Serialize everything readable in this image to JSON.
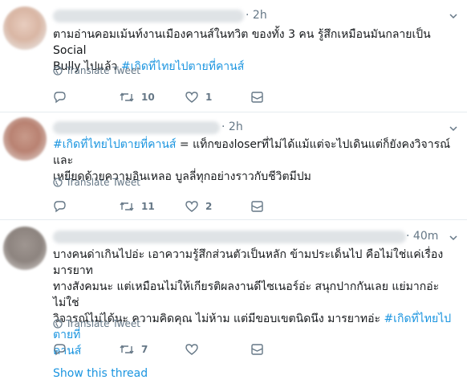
{
  "tweets": [
    {
      "time": "2h",
      "text_lines": [
        {
          "plain": "ตามอ่านคอมเม้นท์งานเมืองคานส์ในทวิต ของทั้ง 3 คน รู้สึกเหมือนมันกลายเป็น Social"
        },
        {
          "plain": "Bully ไปแล้ว ",
          "hashtag": "#เกิดที่ไทยไปตายที่คานส์"
        }
      ],
      "translate": "Translate Tweet",
      "retweets": "10",
      "likes": "1"
    },
    {
      "time": "2h",
      "text_lines": [
        {
          "hashtag": "#เกิดที่ไทยไปตายที่คานส์",
          "plain": " = แท็กของloserที่ไม่ได้แม้แต่จะไปเดินแต่ก็ยังคงวิจารณ์และ"
        },
        {
          "plain": "เหยียดด้วยความอินเหลอ บูลลี่ทุกอย่างราวกับชีวิตมีปม"
        }
      ],
      "translate": "Translate Tweet",
      "retweets": "11",
      "likes": "2"
    },
    {
      "time": "40m",
      "text_lines": [
        {
          "plain": "บางคนด่าเกินไปอ่ะ เอาความรู้สึกส่วนตัวเป็นหลัก ข้ามประเด็นไป คือไม่ใช่แค่เรื่องมารยาท"
        },
        {
          "plain": "ทางสังคมนะ แต่เหมือนไม่ให้เกียรติผลงานดีไซเนอร์อ่ะ สนุกปากกันเลย แย่มากอ่ะ ไม่ใช่"
        },
        {
          "plain": "วิจารณ์ไม่ได้นะ ความคิดคุณ ไม่ห้าม แต่มีขอบเขตนิดนึง มารยาทอ่ะ ",
          "hashtag": "#เกิดที่ไทยไปตายที่"
        },
        {
          "hashtag": "คานส์"
        }
      ],
      "translate": "Translate Tweet",
      "retweets": "7",
      "likes": "",
      "show_thread": "Show this thread"
    }
  ],
  "colors": {
    "link": "#1b95e0",
    "muted": "#657786",
    "text": "#14171a",
    "border": "#e6ecf0"
  },
  "icons": [
    "reply-icon",
    "retweet-icon",
    "like-icon",
    "dm-icon",
    "globe-icon",
    "chevron-down-icon"
  ]
}
